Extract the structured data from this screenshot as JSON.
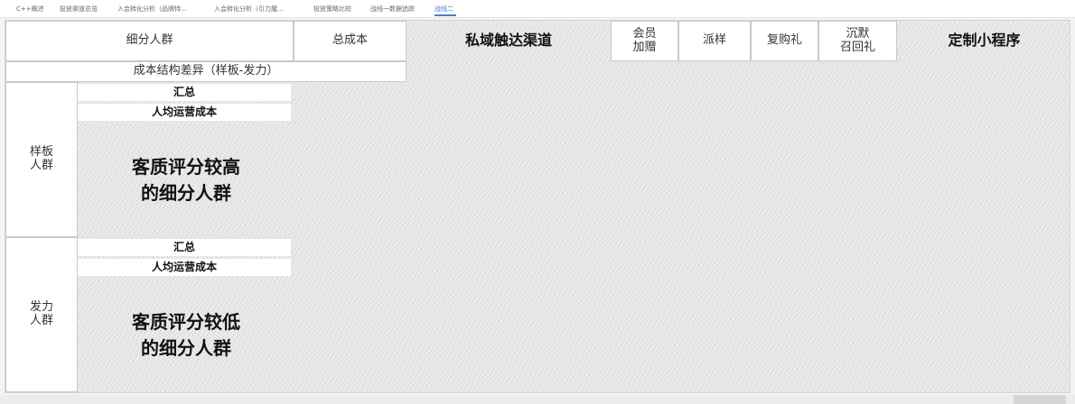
{
  "tabs": [
    {
      "label": "C++概述"
    },
    {
      "label": "投放渠道总览"
    },
    {
      "label": "入会转化分析（品牌特..."
    },
    {
      "label": "入会转化分析（引力魔..."
    },
    {
      "label": "投放策略比较"
    },
    {
      "label": "战线一数据追踪"
    },
    {
      "label": "战线二"
    }
  ],
  "header": {
    "segment": "细分人群",
    "total_cost": "总成本",
    "channel": "私域触达渠道",
    "member_gift": "会员\n加赠",
    "sample": "派样",
    "repurchase_gift": "复购礼",
    "silent_recall": "沉默\n召回礼",
    "mini_program": "定制小程序",
    "cost_diff": "成本结构差异（样板-发力）"
  },
  "groups": [
    {
      "name": "样板\n人群",
      "summary": "汇总",
      "per_capita": "人均运营成本",
      "desc": "客质评分较高\n的细分人群"
    },
    {
      "name": "发力\n人群",
      "summary": "汇总",
      "per_capita": "人均运营成本",
      "desc": "客质评分较低\n的细分人群"
    }
  ]
}
